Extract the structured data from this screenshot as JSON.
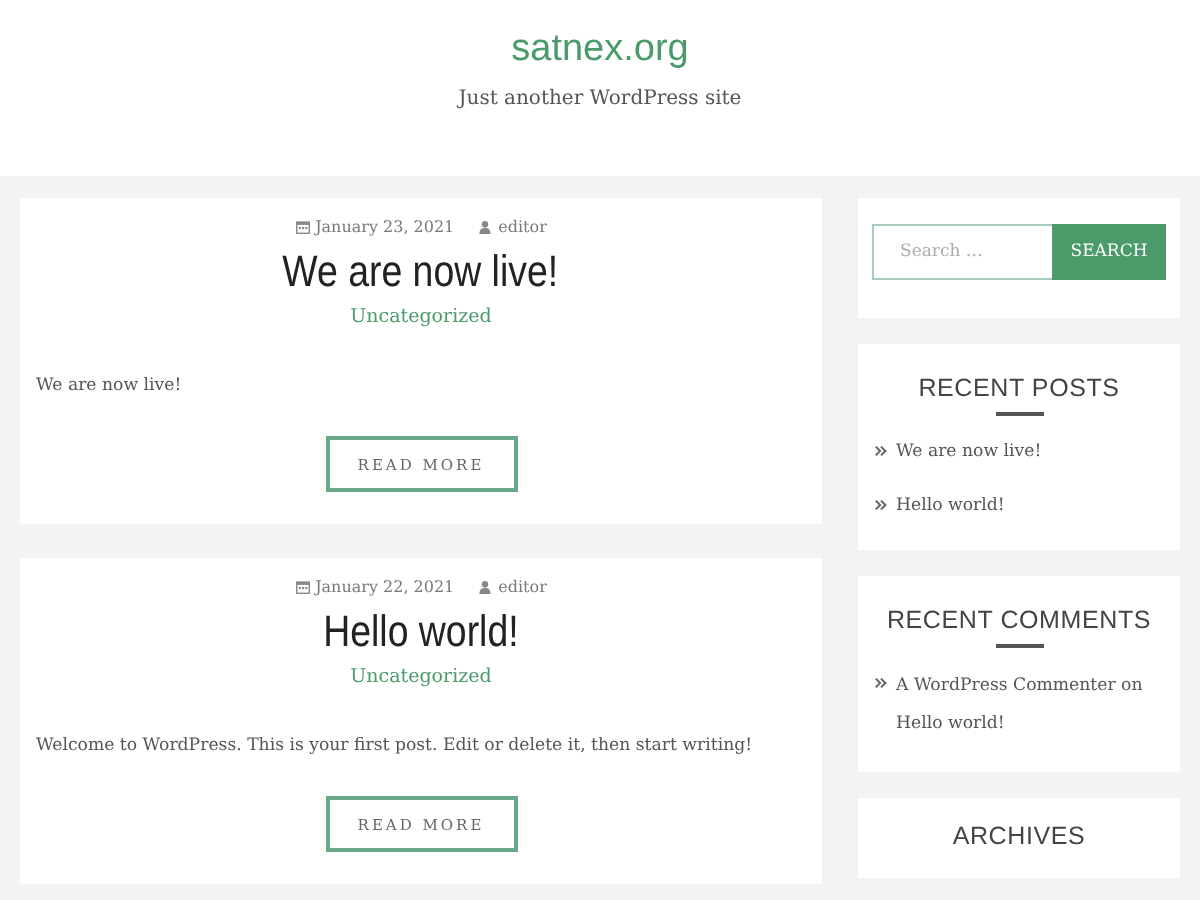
{
  "site": {
    "title": "satnex.org",
    "tagline": "Just another WordPress site"
  },
  "posts": [
    {
      "date": "January 23, 2021",
      "author": "editor",
      "title": "We are now live!",
      "category": "Uncategorized",
      "excerpt": "We are now live!",
      "button": "READ MORE"
    },
    {
      "date": "January 22, 2021",
      "author": "editor",
      "title": "Hello world!",
      "category": "Uncategorized",
      "excerpt": "Welcome to WordPress. This is your first post. Edit or delete it, then start writing!",
      "button": "READ MORE"
    }
  ],
  "search": {
    "placeholder": "Search …",
    "button": "SEARCH"
  },
  "recent_posts": {
    "heading": "RECENT POSTS",
    "items": [
      "We are now live!",
      "Hello world!"
    ]
  },
  "recent_comments": {
    "heading": "RECENT COMMENTS",
    "items": [
      {
        "author": "A WordPress Commenter",
        "joiner": "on",
        "post": "Hello world!"
      }
    ]
  },
  "archives": {
    "heading": "ARCHIVES"
  }
}
